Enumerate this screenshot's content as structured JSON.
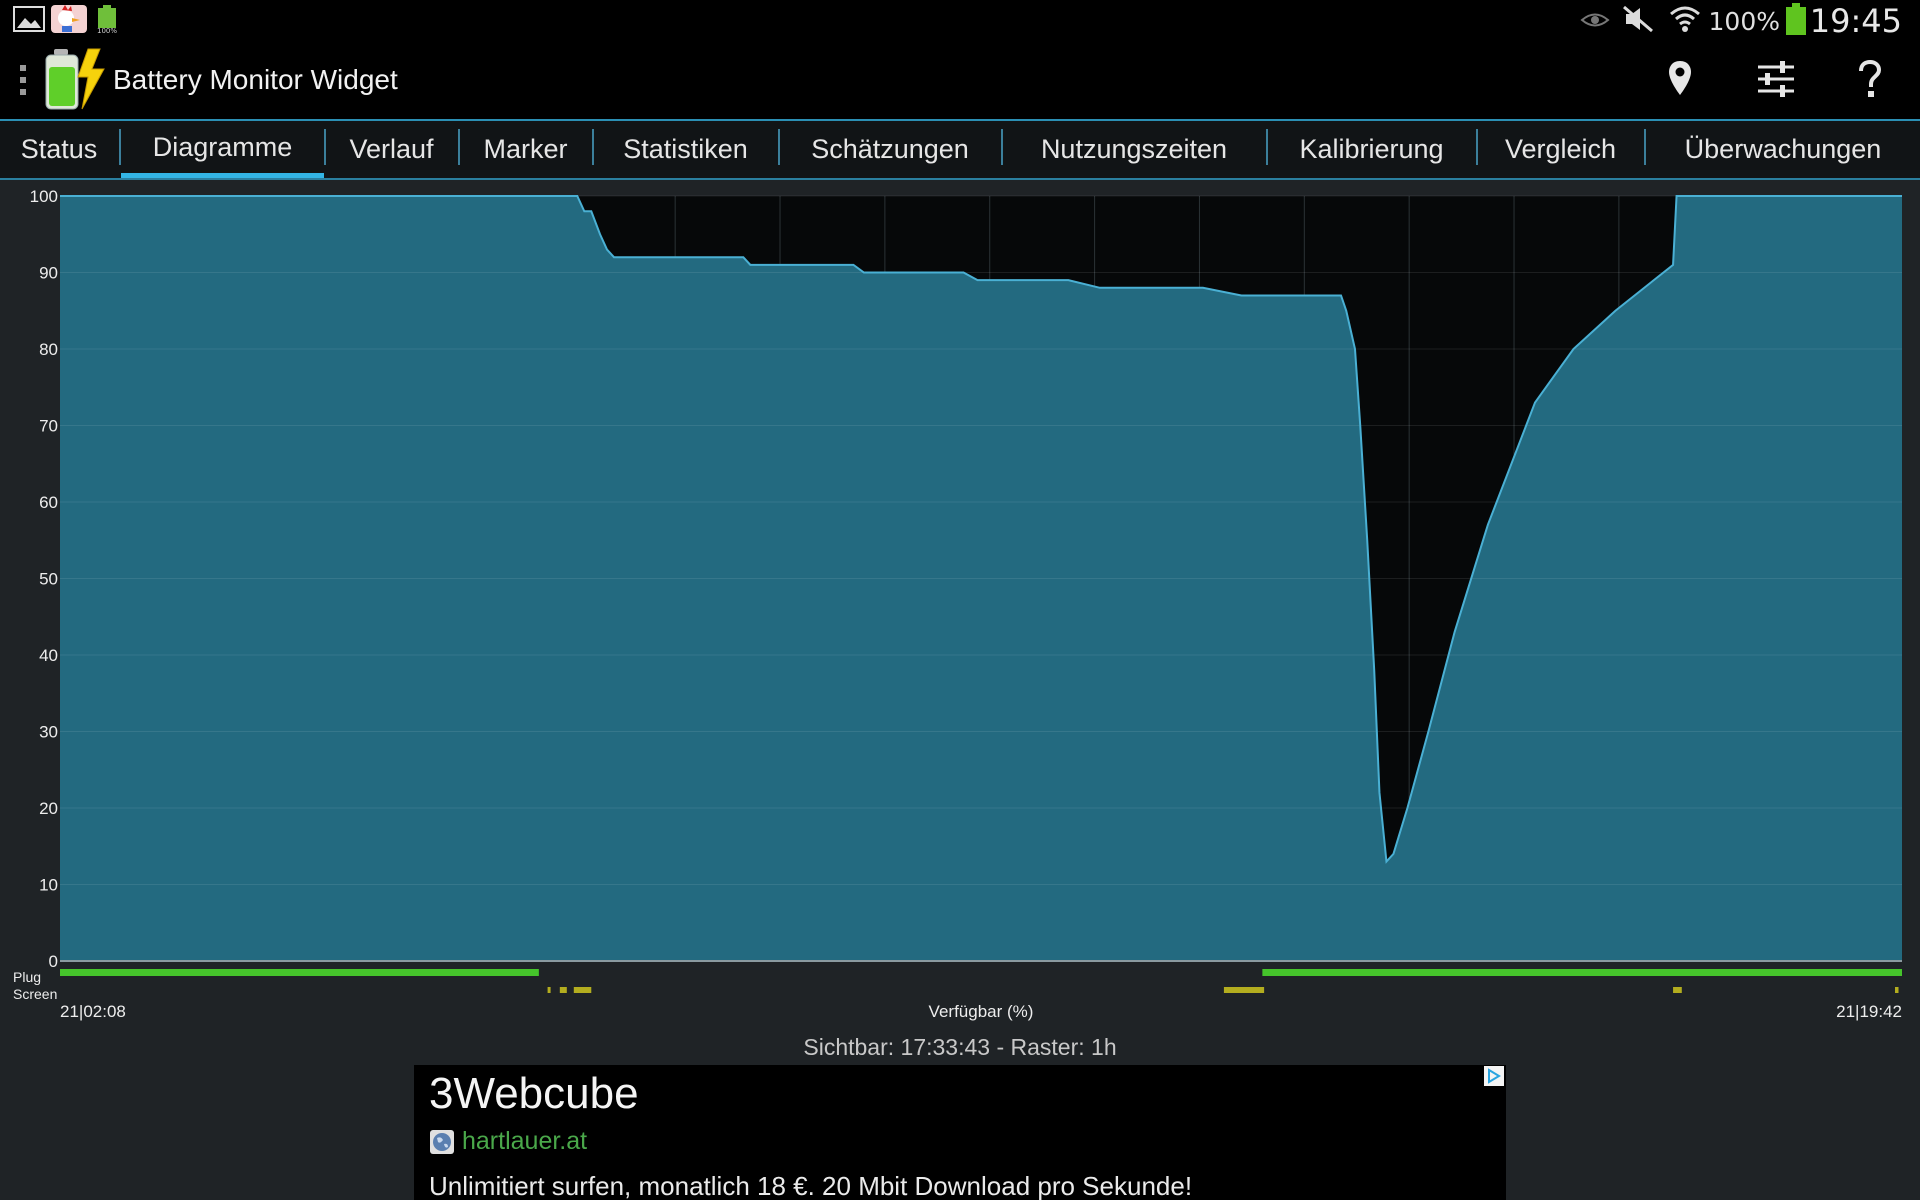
{
  "status_bar": {
    "battery_percent": "100%",
    "clock": "19:45",
    "notification_icons": [
      "gallery-icon",
      "chicken-app-icon",
      "battery-widget-icon"
    ],
    "system_icons": [
      "smart-stay-eye-icon",
      "mute-icon",
      "wifi-icon",
      "battery-icon"
    ]
  },
  "action_bar": {
    "title": "Battery Monitor Widget",
    "actions": [
      "location-pin-icon",
      "sliders-settings-icon",
      "help-icon"
    ]
  },
  "tabs": [
    {
      "label": "Status",
      "active": false
    },
    {
      "label": "Diagramme",
      "active": true
    },
    {
      "label": "Verlauf",
      "active": false
    },
    {
      "label": "Marker",
      "active": false
    },
    {
      "label": "Statistiken",
      "active": false
    },
    {
      "label": "Schätzungen",
      "active": false
    },
    {
      "label": "Nutzungszeiten",
      "active": false
    },
    {
      "label": "Kalibrierung",
      "active": false
    },
    {
      "label": "Vergleich",
      "active": false
    },
    {
      "label": "Überwachungen",
      "active": false
    }
  ],
  "chart_data": {
    "type": "area",
    "xlabel": "Verfügbar (%)",
    "x_start_label": "21|02:08",
    "x_end_label": "21|19:42",
    "x_start_minutes": 128,
    "x_end_minutes": 1182,
    "ylim": [
      0,
      100
    ],
    "y_ticks": [
      0,
      10,
      20,
      30,
      40,
      50,
      60,
      70,
      80,
      90,
      100
    ],
    "grid": true,
    "fill_color": "#236a80",
    "line_color": "#4ab0d4",
    "points": [
      [
        128,
        100
      ],
      [
        424,
        100
      ],
      [
        428,
        98
      ],
      [
        432,
        98
      ],
      [
        437,
        95
      ],
      [
        441,
        93
      ],
      [
        445,
        92
      ],
      [
        519,
        92
      ],
      [
        523,
        91
      ],
      [
        582,
        91
      ],
      [
        588,
        90
      ],
      [
        645,
        90
      ],
      [
        653,
        89
      ],
      [
        705,
        89
      ],
      [
        723,
        88
      ],
      [
        782,
        88
      ],
      [
        804,
        87
      ],
      [
        861,
        87
      ],
      [
        864,
        85
      ],
      [
        869,
        80
      ],
      [
        872,
        70
      ],
      [
        876,
        55
      ],
      [
        880,
        38
      ],
      [
        883,
        22
      ],
      [
        887,
        13
      ],
      [
        891,
        14
      ],
      [
        899,
        20
      ],
      [
        911,
        30
      ],
      [
        926,
        43
      ],
      [
        945,
        57
      ],
      [
        972,
        73
      ],
      [
        994,
        80
      ],
      [
        1018,
        85
      ],
      [
        1040,
        89
      ],
      [
        1051,
        91
      ],
      [
        1053,
        100
      ],
      [
        1182,
        100
      ]
    ],
    "tracks": [
      {
        "name": "Plug",
        "color": "#45c42b",
        "segments": [
          [
            128,
            402
          ],
          [
            816,
            1182
          ]
        ]
      },
      {
        "name": "Screen",
        "color": "#b3ad1f",
        "segments": [
          [
            407,
            408
          ],
          [
            414,
            418
          ],
          [
            422,
            432
          ],
          [
            794,
            817
          ],
          [
            1051,
            1056
          ],
          [
            1178,
            1180
          ]
        ]
      }
    ]
  },
  "visible_info": "Sichtbar: 17:33:43 - Raster: 1h",
  "ad": {
    "title": "3Webcube",
    "domain": "hartlauer.at",
    "text": "Unlimitiert surfen, monatlich 18 €. 20 Mbit Download pro Sekunde!",
    "adchoices_icon": "adchoices-icon"
  }
}
